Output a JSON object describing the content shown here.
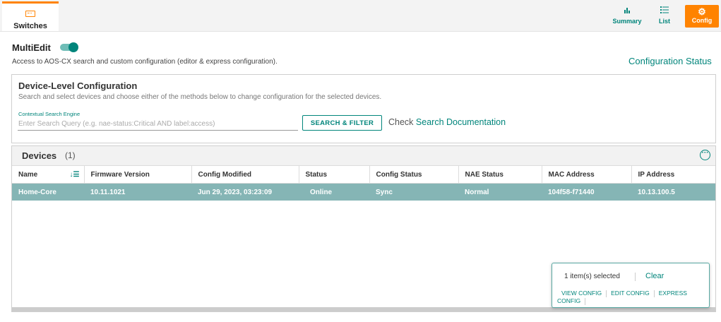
{
  "tabs": {
    "switches_label": "Switches"
  },
  "views": {
    "summary_label": "Summary",
    "list_label": "List",
    "config_label": "Config"
  },
  "multiedit": {
    "label": "MultiEdit",
    "enabled": true,
    "description": "Access to AOS-CX search and custom configuration (editor & express configuration).",
    "config_status_link": "Configuration Status"
  },
  "device_level": {
    "title": "Device-Level Configuration",
    "description": "Search and select devices and choose either of the methods below to change configuration for the selected devices.",
    "search_label": "Contextual Search Engine",
    "search_placeholder": "Enter Search Query (e.g. nae-status:Critical AND label:access)",
    "search_value": "",
    "search_button": "SEARCH & FILTER",
    "check_text": "Check",
    "doc_link": "Search Documentation"
  },
  "devices": {
    "title": "Devices",
    "count": "(1)",
    "columns": [
      "Name",
      "Firmware Version",
      "Config Modified",
      "Status",
      "Config Status",
      "NAE Status",
      "MAC Address",
      "IP Address"
    ],
    "rows": [
      [
        "Home-Core",
        "10.11.1021",
        "Jun 29, 2023, 03:23:09",
        "Online",
        "Sync",
        "Normal",
        "104f58-f71440",
        "10.13.100.5"
      ]
    ]
  },
  "selection": {
    "count_text": "1 item(s) selected",
    "clear": "Clear",
    "view_config": "VIEW CONFIG",
    "edit_config": "EDIT CONFIG",
    "express_config": "EXPRESS CONFIG"
  },
  "colors": {
    "accent": "#01857b",
    "brand": "#ff8300",
    "selected_row": "#85b5b5"
  },
  "icons": [
    "switch-icon",
    "summary-bar-chart-icon",
    "list-icon",
    "gear-icon",
    "sort-icon",
    "more-options-icon"
  ]
}
